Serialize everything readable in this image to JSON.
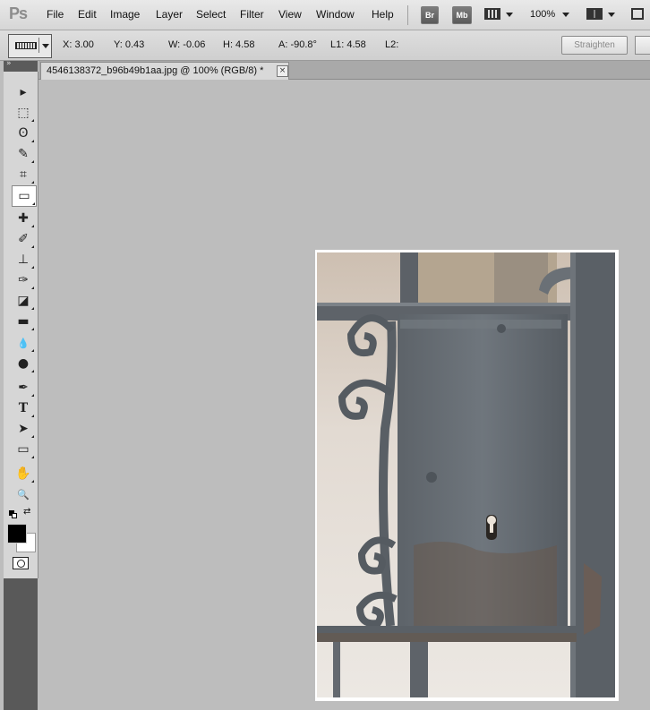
{
  "app": {
    "logo": "Ps"
  },
  "menu": [
    "File",
    "Edit",
    "Image",
    "Layer",
    "Select",
    "Filter",
    "View",
    "Window",
    "Help"
  ],
  "toolbar": {
    "bridge": "Br",
    "minibridge": "Mb",
    "zoom": "100%"
  },
  "options": {
    "x": "X: 3.00",
    "y": "Y: 0.43",
    "w": "W: -0.06",
    "h": "H: 4.58",
    "a": "A: -90.8°",
    "l1": "L1: 4.58",
    "l2": "L2:",
    "straighten": "Straighten"
  },
  "document": {
    "title": "4546138372_b96b49b1aa.jpg @ 100% (RGB/8) *",
    "close": "×"
  },
  "tools": [
    {
      "name": "move-tool-icon",
      "glyph": "▸"
    },
    {
      "name": "marquee-tool-icon",
      "glyph": "⬚"
    },
    {
      "name": "lasso-tool-icon",
      "glyph": "ʘ"
    },
    {
      "name": "quick-selection-tool-icon",
      "glyph": "✎"
    },
    {
      "name": "crop-tool-icon",
      "glyph": "⌗"
    },
    {
      "name": "ruler-tool-icon",
      "glyph": "▭"
    },
    {
      "name": "healing-brush-tool-icon",
      "glyph": "✚"
    },
    {
      "name": "brush-tool-icon",
      "glyph": "✐"
    },
    {
      "name": "clone-stamp-tool-icon",
      "glyph": "⊥"
    },
    {
      "name": "history-brush-tool-icon",
      "glyph": "✑"
    },
    {
      "name": "eraser-tool-icon",
      "glyph": "◪"
    },
    {
      "name": "gradient-tool-icon",
      "glyph": "▬"
    },
    {
      "name": "blur-tool-icon",
      "glyph": "💧"
    },
    {
      "name": "dodge-tool-icon",
      "glyph": "●"
    },
    {
      "name": "pen-tool-icon",
      "glyph": "✒"
    },
    {
      "name": "type-tool-icon",
      "glyph": "T"
    },
    {
      "name": "path-selection-tool-icon",
      "glyph": "➤"
    },
    {
      "name": "shape-tool-icon",
      "glyph": "▭"
    },
    {
      "name": "hand-tool-icon",
      "glyph": "✋"
    },
    {
      "name": "zoom-tool-icon",
      "glyph": "🔍"
    }
  ],
  "colors": {
    "foreground": "#000000",
    "background": "#ffffff",
    "canvas_bg": "#bdbdbd"
  }
}
